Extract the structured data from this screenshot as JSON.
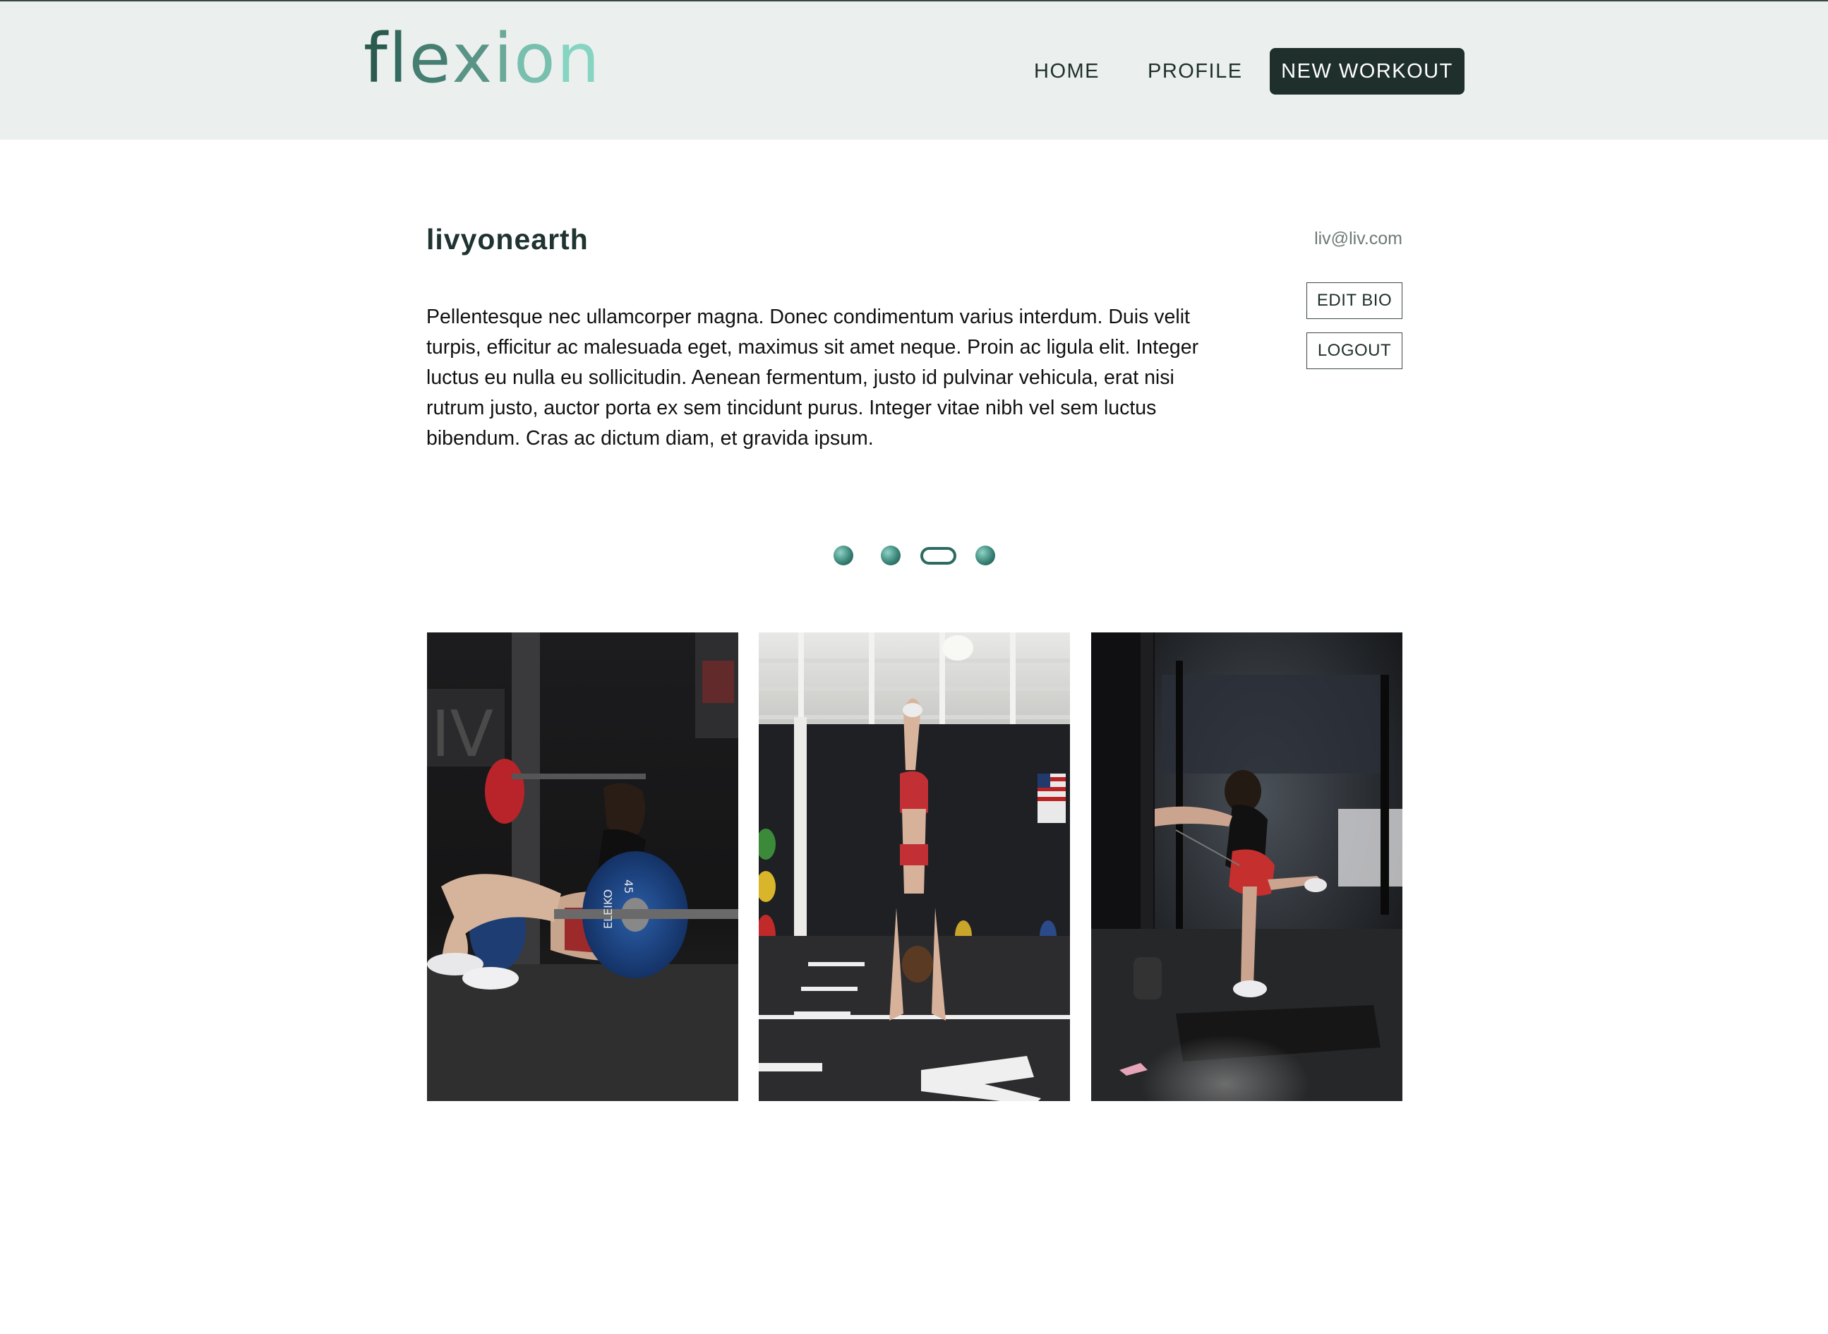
{
  "header": {
    "logo": {
      "letters": [
        "f",
        "l",
        "e",
        "x",
        "i",
        "o",
        "n"
      ],
      "colors": [
        "#2b5a4e",
        "#356b5e",
        "#467f71",
        "#5a9486",
        "#6aa898",
        "#78bfae",
        "#86d4c2"
      ]
    },
    "nav": {
      "home": "HOME",
      "profile": "PROFILE",
      "new_workout": "NEW WORKOUT"
    }
  },
  "profile": {
    "username": "livyonearth",
    "email": "liv@liv.com",
    "bio": "Pellentesque nec ullamcorper magna. Donec condimentum varius interdum. Duis velit turpis, efficitur ac malesuada eget, maximus sit amet neque. Proin ac ligula elit. Integer luctus eu nulla eu sollicitudin. Aenean fermentum, justo id pulvinar vehicula, erat nisi rutrum justo, auctor porta ex sem tincidunt purus. Integer vitae nibh vel sem luctus bibendum. Cras ac dictum diam, et gravida ipsum.",
    "edit_bio": "EDIT BIO",
    "logout": "LOGOUT"
  },
  "carousel": {
    "total_pages": 4,
    "active_page": 3
  },
  "photos": [
    {
      "subject": "woman doing barbell hip thrust with blue plate in gym"
    },
    {
      "subject": "woman in handstand on gym turf floor"
    },
    {
      "subject": "woman doing cable kickback in dark gym"
    }
  ],
  "colors": {
    "header_bg": "#ebf0ee",
    "primary_dark": "#1f2f2c",
    "accent_teal": "#3a8478"
  }
}
